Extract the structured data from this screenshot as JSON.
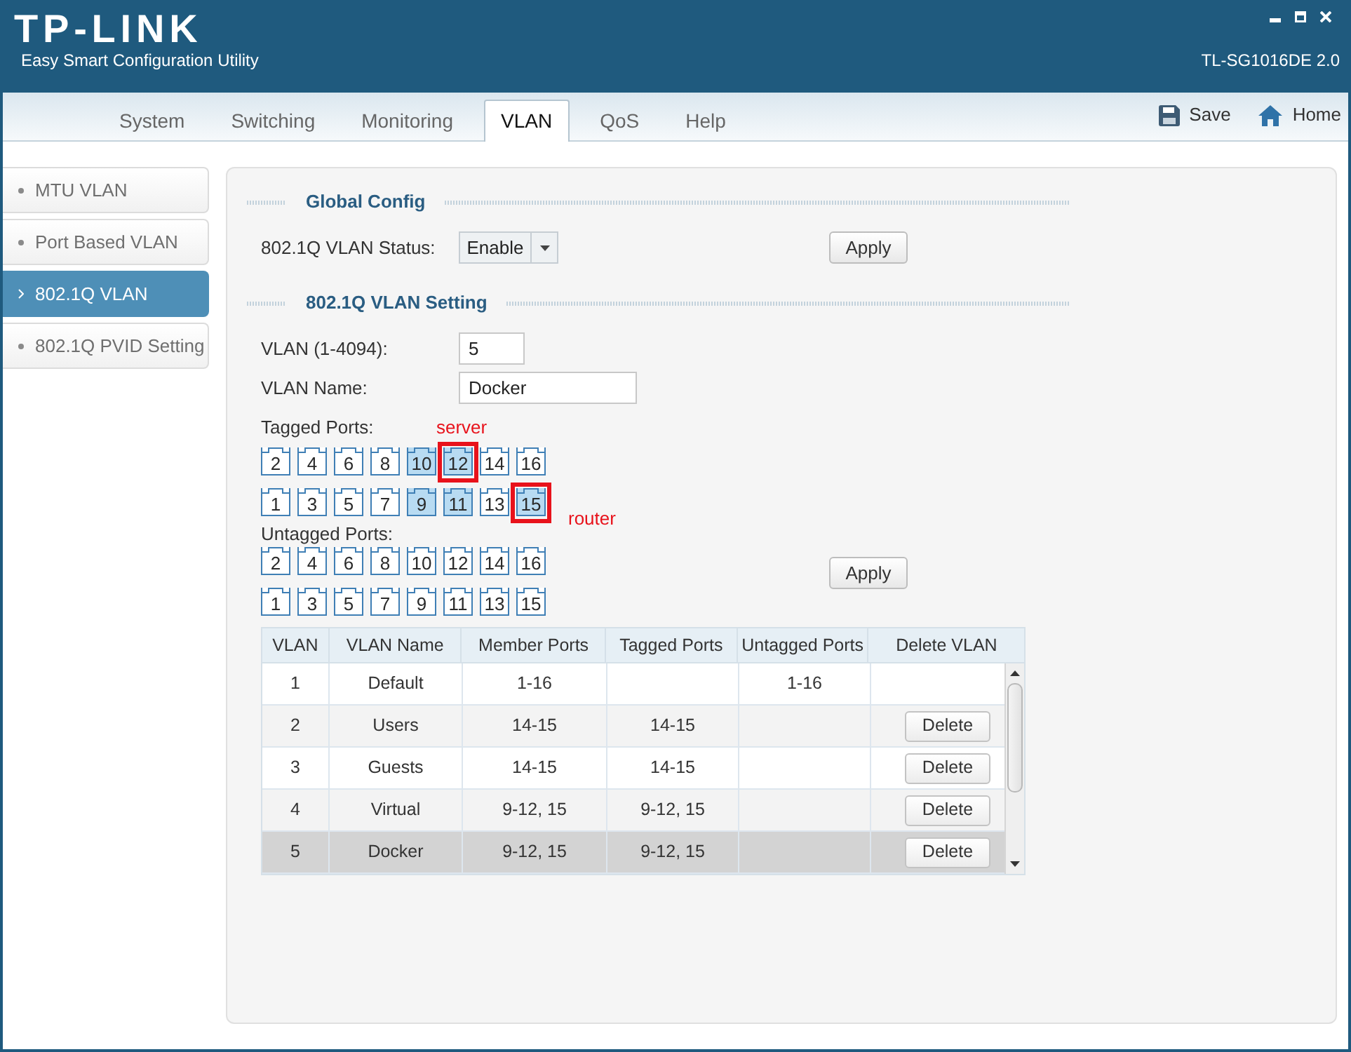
{
  "window": {
    "logo": "TP-LINK",
    "subtitle": "Easy Smart Configuration Utility",
    "model": "TL-SG1016DE 2.0"
  },
  "tabs": [
    {
      "label": "System",
      "selected": false
    },
    {
      "label": "Switching",
      "selected": false
    },
    {
      "label": "Monitoring",
      "selected": false
    },
    {
      "label": "VLAN",
      "selected": true
    },
    {
      "label": "QoS",
      "selected": false
    },
    {
      "label": "Help",
      "selected": false
    }
  ],
  "toolbar": [
    {
      "kind": "save",
      "label": "Save"
    },
    {
      "kind": "home",
      "label": "Home"
    }
  ],
  "sidebar": {
    "items": [
      {
        "label": "MTU VLAN",
        "selected": false
      },
      {
        "label": "Port Based VLAN",
        "selected": false
      },
      {
        "label": "802.1Q VLAN",
        "selected": true
      },
      {
        "label": "802.1Q PVID Setting",
        "selected": false
      }
    ]
  },
  "global_config": {
    "title": "Global Config",
    "status_label": "802.1Q VLAN Status:",
    "status_value": "Enable",
    "apply": "Apply"
  },
  "vlan_setting": {
    "title": "802.1Q VLAN Setting",
    "vlan_id_label": "VLAN (1-4094):",
    "vlan_id": "5",
    "vlan_name_label": "VLAN Name:",
    "vlan_name": "Docker",
    "tagged_ports": {
      "label": "Tagged Ports:",
      "rows": [
        [
          {
            "number": "2",
            "selected": false
          },
          {
            "number": "4",
            "selected": false
          },
          {
            "number": "6",
            "selected": false
          },
          {
            "number": "8",
            "selected": false
          },
          {
            "number": "10",
            "selected": true
          },
          {
            "number": "12",
            "selected": true,
            "note_above": "server"
          },
          {
            "number": "14",
            "selected": false
          },
          {
            "number": "16",
            "selected": false
          }
        ],
        [
          {
            "number": "1",
            "selected": false
          },
          {
            "number": "3",
            "selected": false
          },
          {
            "number": "5",
            "selected": false
          },
          {
            "number": "7",
            "selected": false
          },
          {
            "number": "9",
            "selected": true
          },
          {
            "number": "11",
            "selected": true
          },
          {
            "number": "13",
            "selected": false
          },
          {
            "number": "15",
            "selected": true,
            "note_beside": "router"
          }
        ]
      ]
    },
    "untagged_ports": {
      "label": "Untagged Ports:",
      "rows": [
        [
          {
            "number": "2",
            "selected": false
          },
          {
            "number": "4",
            "selected": false
          },
          {
            "number": "6",
            "selected": false
          },
          {
            "number": "8",
            "selected": false
          },
          {
            "number": "10",
            "selected": false
          },
          {
            "number": "12",
            "selected": false
          },
          {
            "number": "14",
            "selected": false
          },
          {
            "number": "16",
            "selected": false
          }
        ],
        [
          {
            "number": "1",
            "selected": false
          },
          {
            "number": "3",
            "selected": false
          },
          {
            "number": "5",
            "selected": false
          },
          {
            "number": "7",
            "selected": false
          },
          {
            "number": "9",
            "selected": false
          },
          {
            "number": "11",
            "selected": false
          },
          {
            "number": "13",
            "selected": false
          },
          {
            "number": "15",
            "selected": false
          }
        ]
      ]
    },
    "apply": "Apply"
  },
  "table": {
    "columns": [
      "VLAN",
      "VLAN Name",
      "Member Ports",
      "Tagged Ports",
      "Untagged Ports",
      "Delete VLAN"
    ],
    "rows": [
      {
        "vlan": "1",
        "name": "Default",
        "member_ports": "1-16",
        "untagged_ports": "1-16",
        "selected": false
      },
      {
        "vlan": "2",
        "name": "Users",
        "member_ports": "14-15",
        "tagged_ports": "14-15",
        "delete": "Delete",
        "selected": false
      },
      {
        "vlan": "3",
        "name": "Guests",
        "member_ports": "14-15",
        "tagged_ports": "14-15",
        "delete": "Delete",
        "selected": false
      },
      {
        "vlan": "4",
        "name": "Virtual",
        "member_ports": "9-12, 15",
        "tagged_ports": "9-12, 15",
        "delete": "Delete",
        "selected": false
      },
      {
        "vlan": "5",
        "name": "Docker",
        "member_ports": "9-12, 15",
        "tagged_ports": "9-12, 15",
        "delete": "Delete",
        "selected": true
      }
    ]
  }
}
